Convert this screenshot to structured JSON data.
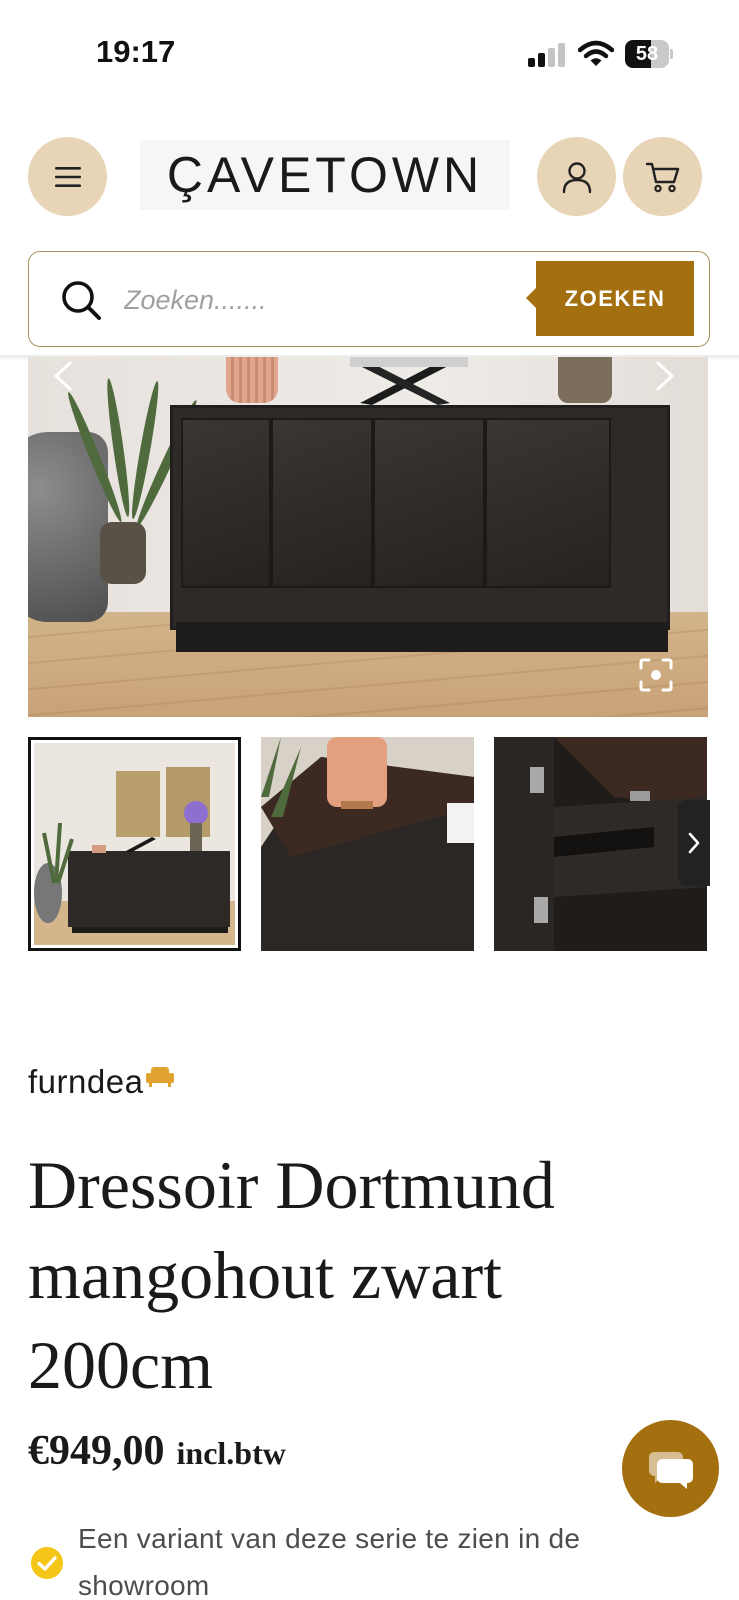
{
  "status_bar": {
    "time": "19:17",
    "battery_level": "58"
  },
  "header": {
    "logo_text": "ÇAVETOWN"
  },
  "search": {
    "placeholder": "Zoeken.......",
    "button_label": "ZOEKEN"
  },
  "product": {
    "brand": "furndea",
    "title": "Dressoir Dortmund mangohout zwart 200cm",
    "price": "€949,00",
    "vat_label": "incl.btw",
    "feature": "Een variant van deze serie te zien in de showroom"
  },
  "colors": {
    "accent": "#a4700f",
    "header_button_bg": "#e8d4b6",
    "check_icon": "#f5c518"
  }
}
